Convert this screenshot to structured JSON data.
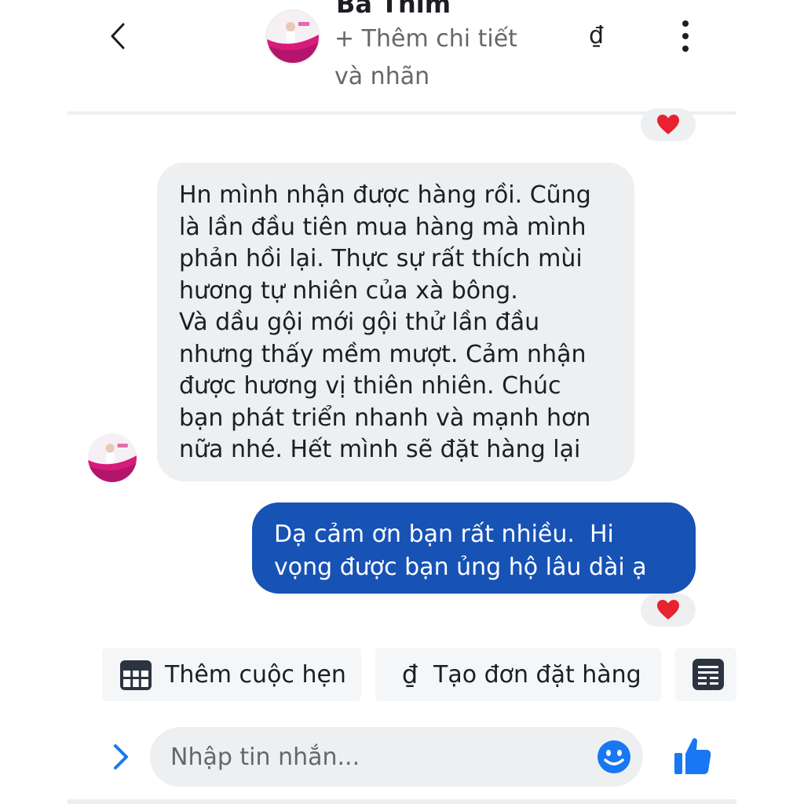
{
  "header": {
    "contact_name": "Bà Thím",
    "add_details_link": "+ Thêm chi tiết và nhãn",
    "currency_symbol": "₫"
  },
  "messages": [
    {
      "direction": "incoming",
      "text": "Hn mình nhận được hàng rồi. Cũng\nlà lần đầu tiên mua hàng mà mình\nphản hồi lại. Thực sự rất thích mùi\nhương tự nhiên của xà bông.\nVà dầu gội mới gội thử lần đầu\nnhưng thấy mềm mượt. Cảm nhận\nđược hương vị thiên nhiên. Chúc\nbạn phát triển nhanh và mạnh hơn\nnữa nhé. Hết mình sẽ đặt hàng lại"
    },
    {
      "direction": "outgoing",
      "text": "Dạ cảm ơn bạn rất nhiều.  Hi\nvọng được bạn ủng hộ lâu dài ạ",
      "reaction": "heart"
    }
  ],
  "quick_actions": [
    {
      "label": "Thêm cuộc hẹn",
      "icon": "calendar-icon"
    },
    {
      "label": "Tạo đơn đặt hàng",
      "icon_text": "₫",
      "icon": "dong-currency-icon"
    },
    {
      "label": "",
      "icon": "document-list-icon"
    }
  ],
  "composer": {
    "placeholder": "Nhập tin nhắn..."
  },
  "colors": {
    "outgoing_bubble": "#1752b5",
    "incoming_bubble": "#eeeff1",
    "accent": "#1877f2",
    "heart": "#e8222f"
  }
}
